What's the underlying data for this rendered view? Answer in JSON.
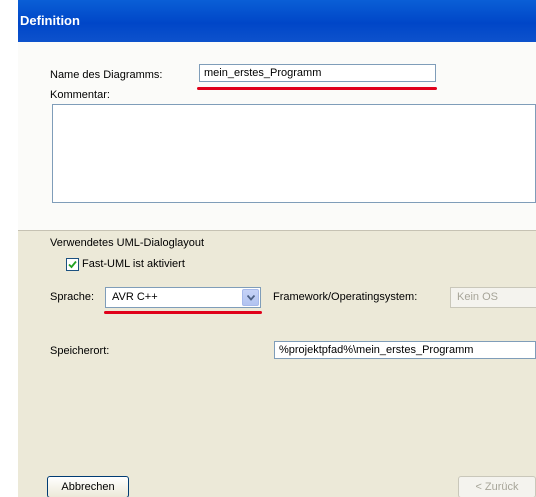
{
  "window": {
    "title": "Definition"
  },
  "form": {
    "name_label": "Name des Diagramms:",
    "name_value": "mein_erstes_Programm",
    "comment_label": "Kommentar:",
    "comment_value": "",
    "layout_label": "Verwendetes UML-Dialoglayout",
    "fast_uml_label": "Fast-UML ist aktiviert",
    "fast_uml_checked": true,
    "language_label": "Sprache:",
    "language_value": "AVR C++",
    "framework_label": "Framework/Operatingsystem:",
    "framework_value": "Kein OS",
    "location_label": "Speicherort:",
    "location_value": "%projektpfad%\\mein_erstes_Programm"
  },
  "buttons": {
    "cancel": "Abbrechen",
    "back": "< Zurück"
  },
  "colors": {
    "titlebar": "#0a5fd6",
    "highlight_underline": "#e0001a",
    "dialog_bg": "#ece9d8"
  }
}
